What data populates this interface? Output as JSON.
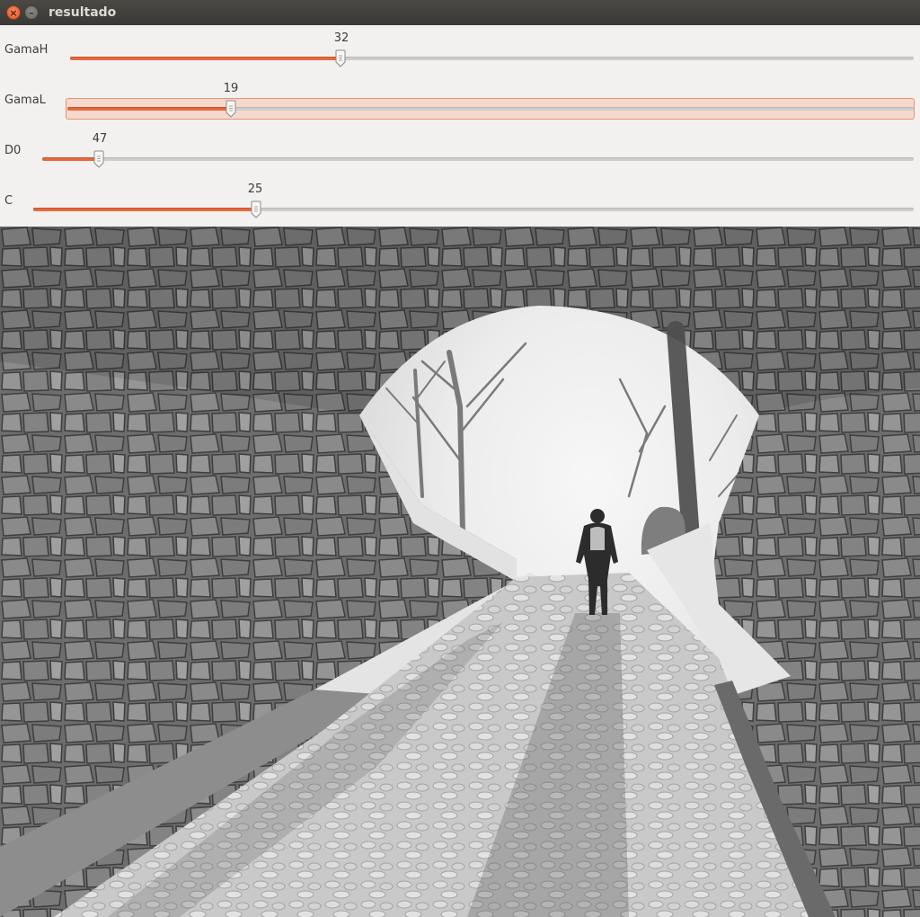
{
  "window": {
    "title": "resultado"
  },
  "titlebar_buttons": {
    "close_glyph": "×",
    "minimize_glyph": "–"
  },
  "sliders": [
    {
      "label": "GamaH",
      "value": "32",
      "fraction": 0.321,
      "focused": false
    },
    {
      "label": "GamaL",
      "value": "19",
      "fraction": 0.193,
      "focused": true
    },
    {
      "label": "D0",
      "value": "47",
      "fraction": 0.065,
      "focused": false
    },
    {
      "label": "C",
      "value": "25",
      "fraction": 0.253,
      "focused": false
    }
  ],
  "colors": {
    "accent": "#e9683c",
    "focus_bg": "#f6d9ce",
    "panel_bg": "#f2f1f0"
  },
  "image": {
    "description": "grayscale photo of a stone archway tunnel, person walking on snowy cobblestone path toward misty trees"
  }
}
